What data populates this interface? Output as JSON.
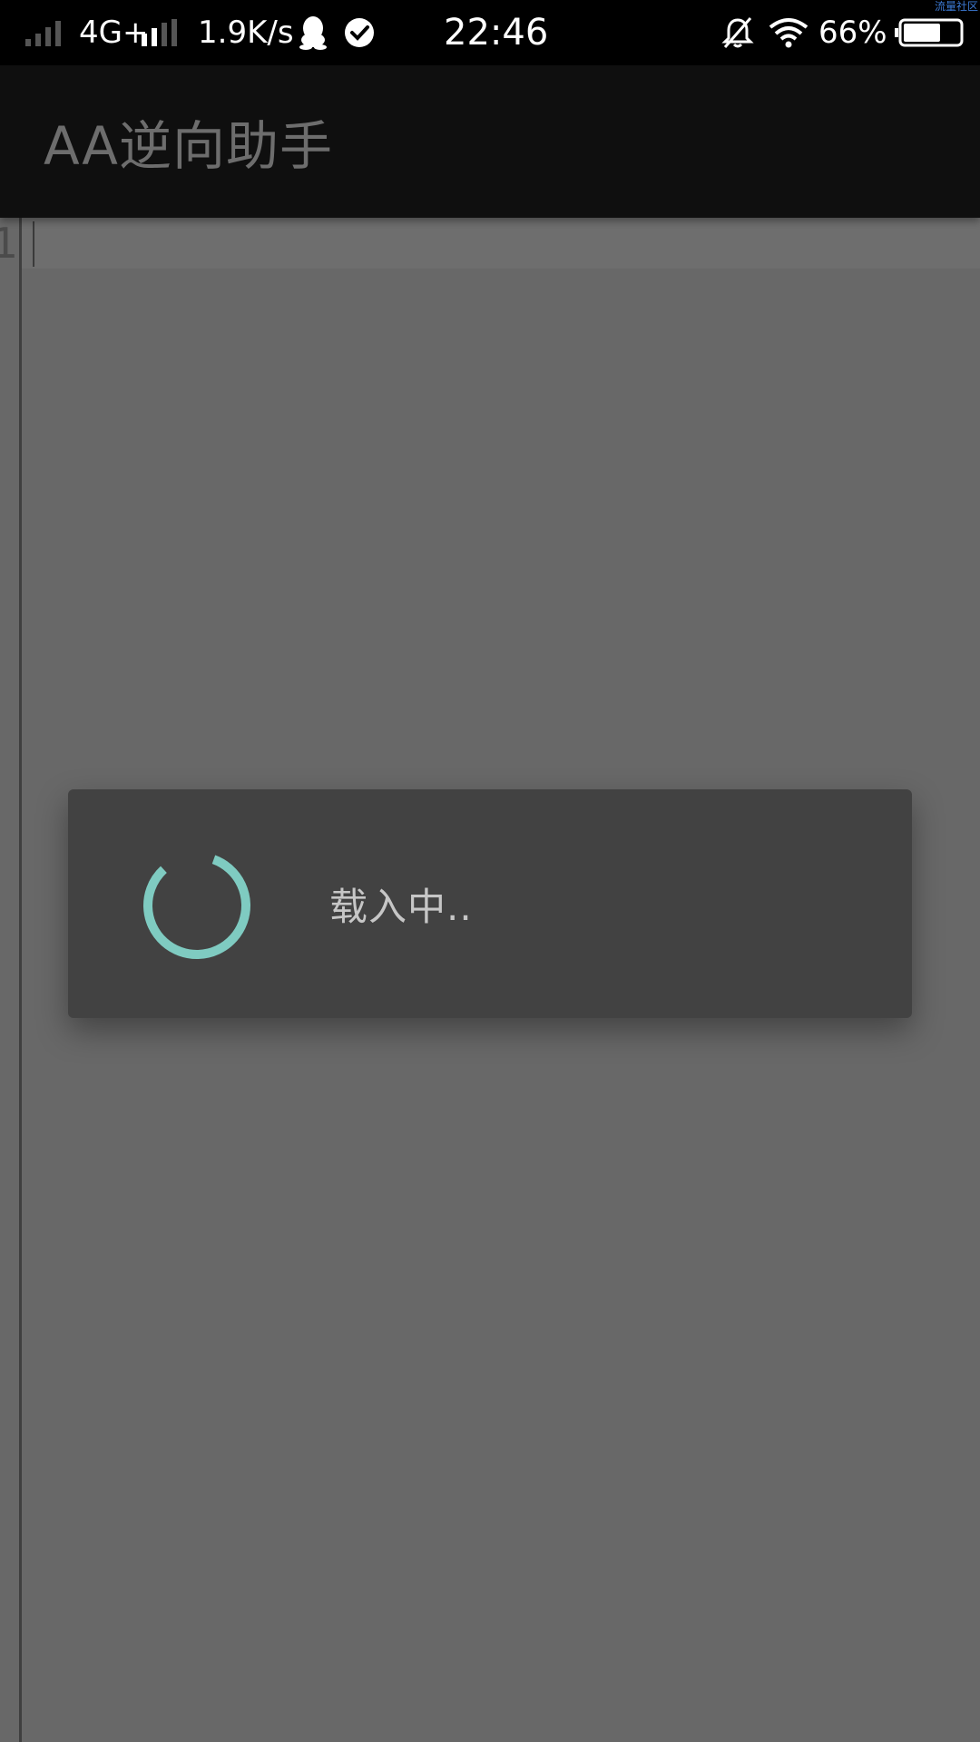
{
  "status_bar": {
    "network_type": "4G+",
    "speed": "1.9K/s",
    "time": "22:46",
    "battery": "66%",
    "battery_level": 0.66,
    "corner_watermark": "流量社区",
    "icons": [
      "signal-icon",
      "qq-icon",
      "check-circle-icon",
      "bell-off-icon",
      "wifi-icon",
      "battery-icon"
    ]
  },
  "app_bar": {
    "title": "AA逆向助手"
  },
  "editor": {
    "line_numbers": [
      "1"
    ]
  },
  "dialog": {
    "message": "载入中.."
  },
  "colors": {
    "accent": "#7fcbc1",
    "app_bar_bg": "#0f0f0f",
    "dim_background": "#686868",
    "dialog_bg": "#424242"
  }
}
